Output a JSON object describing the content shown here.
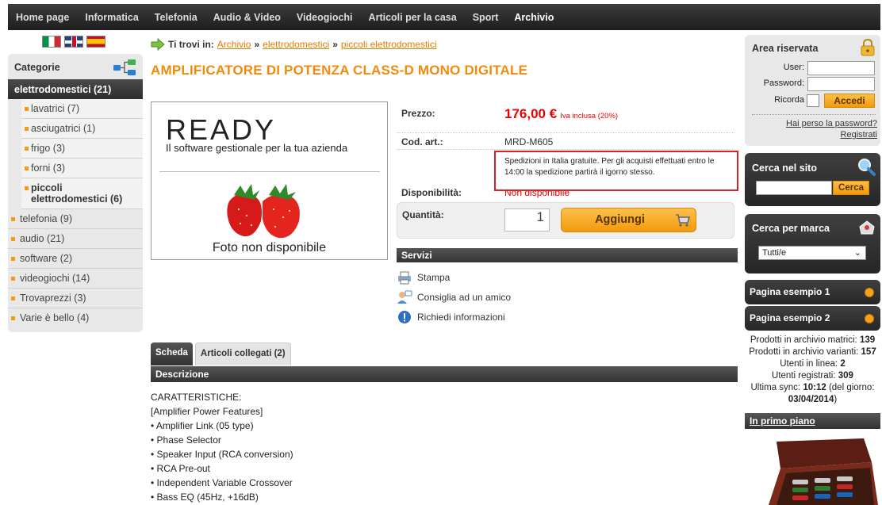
{
  "nav": {
    "items": [
      "Home page",
      "Informatica",
      "Telefonia",
      "Audio & Video",
      "Videogiochi",
      "Articoli per la casa",
      "Sport",
      "Archivio"
    ],
    "active": "Archivio"
  },
  "sidebar": {
    "title": "Categorie",
    "active_category": "elettrodomestici (21)",
    "subcategories": [
      "lavatrici (7)",
      "asciugatrici (1)",
      "frigo (3)",
      "forni (3)",
      "piccoli elettrodomestici (6)"
    ],
    "categories": [
      "telefonia (9)",
      "audio (21)",
      "software (2)",
      "videogiochi (14)",
      "Trovaprezzi (3)",
      "Varie è bello (4)"
    ]
  },
  "breadcrumb": {
    "label": "Ti trovi in:",
    "items": [
      "Archivio",
      "elettrodomestici",
      "piccoli elettrodomestici"
    ],
    "separator": "»"
  },
  "product": {
    "title": "AMPLIFICATORE DI POTENZA CLASS-D MONO DIGITALE",
    "image": {
      "logo": "READY",
      "tagline": "Il software gestionale per la tua azienda",
      "placeholder": "Foto non disponibile"
    },
    "price_label": "Prezzo:",
    "price": "176,00 €",
    "price_note": "Iva inclusa (20%)",
    "code_label": "Cod. art.:",
    "code": "MRD-M605",
    "shipping_note": "Spedizioni in Italia gratuite. Per gli acquisti effettuati entro le 14:00 la spedizione partirà il igorno stesso.",
    "availability_label": "Disponibilità:",
    "availability": "Non disponibile",
    "quantity_label": "Quantità:",
    "quantity": "1",
    "add_button": "Aggiungi"
  },
  "services": {
    "title": "Servizi",
    "items": [
      "Stampa",
      "Consiglia ad un amico",
      "Richiedi informazioni"
    ]
  },
  "tabs": [
    "Scheda",
    "Articoli collegati (2)"
  ],
  "description": {
    "title": "Descrizione",
    "lines": [
      "CARATTERISTICHE:",
      "[Amplifier Power Features]",
      "• Amplifier Link (05 type)",
      "• Phase Selector",
      "• Speaker Input (RCA conversion)",
      "• RCA Pre-out",
      "• Independent Variable Crossover",
      "• Bass EQ (45Hz, +16dB)"
    ]
  },
  "login": {
    "title": "Area riservata",
    "user_label": "User:",
    "password_label": "Password:",
    "remember_label": "Ricorda",
    "button": "Accedi",
    "forgot": "Hai perso la password?",
    "register": "Registrati"
  },
  "search": {
    "title": "Cerca nel sito",
    "button": "Cerca"
  },
  "brand": {
    "title": "Cerca per marca",
    "selected": "Tutti/e"
  },
  "pages": [
    "Pagina esempio 1",
    "Pagina esempio 2"
  ],
  "stats": {
    "matrici_label": "Prodotti in archivio matrici:",
    "matrici": "139",
    "varianti_label": "Prodotti in archivio varianti:",
    "varianti": "157",
    "online_label": "Utenti in linea:",
    "online": "2",
    "registrati_label": "Utenti registrati:",
    "registrati": "309",
    "sync_label": "Ultima sync:",
    "sync_time": "10:12",
    "sync_mid": "(del giorno:",
    "sync_date": "03/04/2014",
    "sync_end": ")"
  },
  "primo_piano": "In primo piano",
  "colors": {
    "accent": "#f28a0e",
    "price": "#e00000",
    "dark_bar": "#333333",
    "highlight_border": "#e02020"
  }
}
